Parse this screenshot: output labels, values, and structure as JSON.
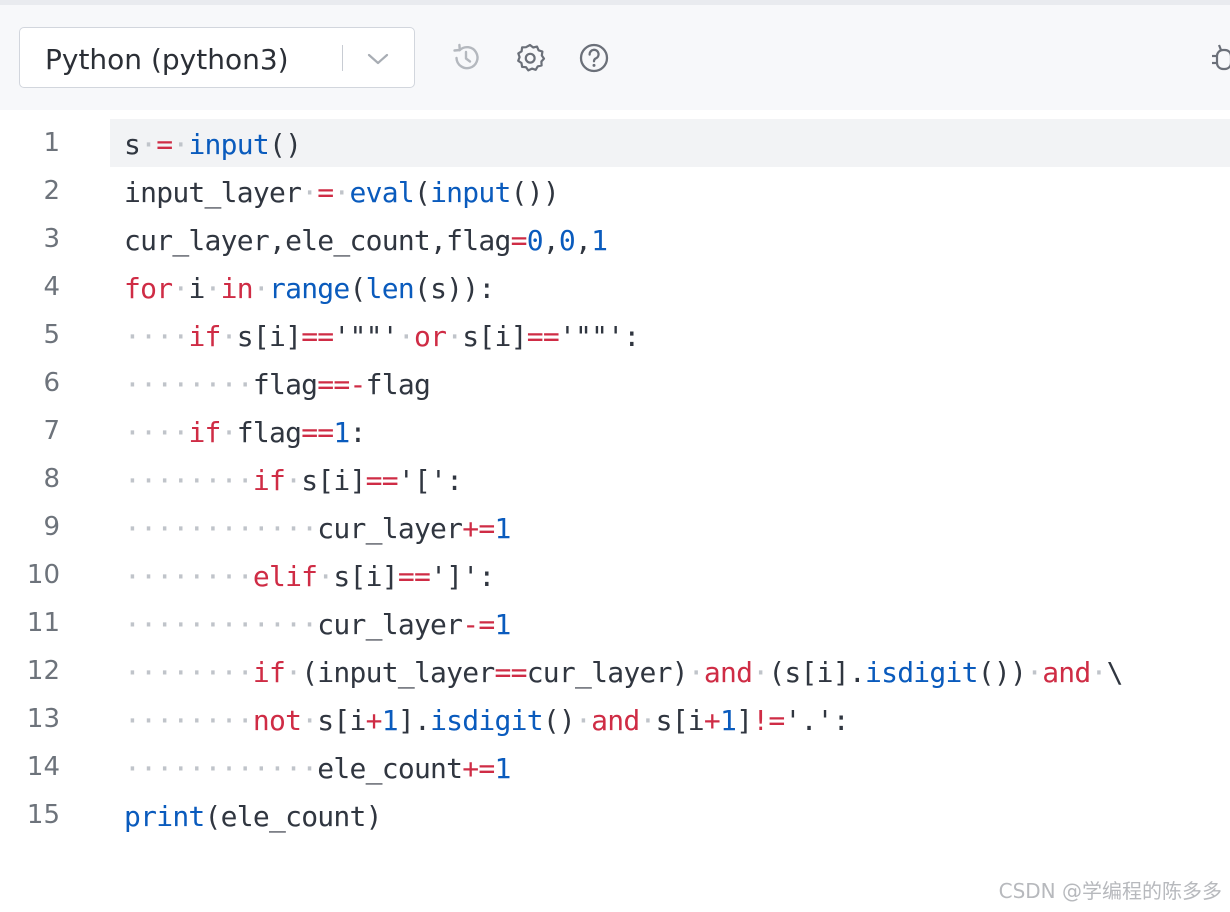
{
  "toolbar": {
    "language": "Python (python3)",
    "icons": [
      "history-icon",
      "settings-icon",
      "help-icon",
      "debug-icon"
    ]
  },
  "editor": {
    "active_line": 1,
    "lines": [
      {
        "n": "1",
        "tokens": [
          [
            "v",
            "s"
          ],
          [
            "w",
            "·"
          ],
          [
            "op",
            "="
          ],
          [
            "w",
            "·"
          ],
          [
            "fn",
            "input"
          ],
          [
            "v",
            "()"
          ]
        ]
      },
      {
        "n": "2",
        "tokens": [
          [
            "v",
            "input_layer"
          ],
          [
            "w",
            "·"
          ],
          [
            "op",
            "="
          ],
          [
            "w",
            "·"
          ],
          [
            "fn",
            "eval"
          ],
          [
            "v",
            "("
          ],
          [
            "fn",
            "input"
          ],
          [
            "v",
            "())"
          ]
        ]
      },
      {
        "n": "3",
        "tokens": [
          [
            "v",
            "cur_layer,ele_count,flag"
          ],
          [
            "op",
            "="
          ],
          [
            "num",
            "0"
          ],
          [
            "v",
            ","
          ],
          [
            "num",
            "0"
          ],
          [
            "v",
            ","
          ],
          [
            "num",
            "1"
          ]
        ]
      },
      {
        "n": "4",
        "tokens": [
          [
            "kw",
            "for"
          ],
          [
            "w",
            "·"
          ],
          [
            "v",
            "i"
          ],
          [
            "w",
            "·"
          ],
          [
            "kw",
            "in"
          ],
          [
            "w",
            "·"
          ],
          [
            "fn",
            "range"
          ],
          [
            "v",
            "("
          ],
          [
            "fn",
            "len"
          ],
          [
            "v",
            "(s)):"
          ]
        ]
      },
      {
        "n": "5",
        "tokens": [
          [
            "w",
            "····"
          ],
          [
            "kw",
            "if"
          ],
          [
            "w",
            "·"
          ],
          [
            "v",
            "s[i]"
          ],
          [
            "op",
            "=="
          ],
          [
            "v",
            "'\"\"'"
          ],
          [
            "w",
            "·"
          ],
          [
            "kw",
            "or"
          ],
          [
            "w",
            "·"
          ],
          [
            "v",
            "s[i]"
          ],
          [
            "op",
            "=="
          ],
          [
            "v",
            "'\"\"':"
          ]
        ]
      },
      {
        "n": "6",
        "tokens": [
          [
            "w",
            "········"
          ],
          [
            "v",
            "flag"
          ],
          [
            "op",
            "==-"
          ],
          [
            "v",
            "flag"
          ]
        ]
      },
      {
        "n": "7",
        "tokens": [
          [
            "w",
            "····"
          ],
          [
            "kw",
            "if"
          ],
          [
            "w",
            "·"
          ],
          [
            "v",
            "flag"
          ],
          [
            "op",
            "=="
          ],
          [
            "num",
            "1"
          ],
          [
            "v",
            ":"
          ]
        ]
      },
      {
        "n": "8",
        "tokens": [
          [
            "w",
            "········"
          ],
          [
            "kw",
            "if"
          ],
          [
            "w",
            "·"
          ],
          [
            "v",
            "s[i]"
          ],
          [
            "op",
            "=="
          ],
          [
            "v",
            "'[':"
          ]
        ]
      },
      {
        "n": "9",
        "tokens": [
          [
            "w",
            "············"
          ],
          [
            "v",
            "cur_layer"
          ],
          [
            "op",
            "+="
          ],
          [
            "num",
            "1"
          ]
        ]
      },
      {
        "n": "10",
        "tokens": [
          [
            "w",
            "········"
          ],
          [
            "kw",
            "elif"
          ],
          [
            "w",
            "·"
          ],
          [
            "v",
            "s[i]"
          ],
          [
            "op",
            "=="
          ],
          [
            "v",
            "']':"
          ]
        ]
      },
      {
        "n": "11",
        "tokens": [
          [
            "w",
            "············"
          ],
          [
            "v",
            "cur_layer"
          ],
          [
            "op",
            "-="
          ],
          [
            "num",
            "1"
          ]
        ]
      },
      {
        "n": "12",
        "tokens": [
          [
            "w",
            "········"
          ],
          [
            "kw",
            "if"
          ],
          [
            "w",
            "·"
          ],
          [
            "v",
            "(input_layer"
          ],
          [
            "op",
            "=="
          ],
          [
            "v",
            "cur_layer)"
          ],
          [
            "w",
            "·"
          ],
          [
            "kw",
            "and"
          ],
          [
            "w",
            "·"
          ],
          [
            "v",
            "(s[i]."
          ],
          [
            "fn",
            "isdigit"
          ],
          [
            "v",
            "())"
          ],
          [
            "w",
            "·"
          ],
          [
            "kw",
            "and"
          ],
          [
            "w",
            "·"
          ],
          [
            "v",
            "\\"
          ]
        ]
      },
      {
        "n": "13",
        "tokens": [
          [
            "w",
            "········"
          ],
          [
            "kw",
            "not"
          ],
          [
            "w",
            "·"
          ],
          [
            "v",
            "s[i"
          ],
          [
            "op",
            "+"
          ],
          [
            "num",
            "1"
          ],
          [
            "v",
            "]."
          ],
          [
            "fn",
            "isdigit"
          ],
          [
            "v",
            "()"
          ],
          [
            "w",
            "·"
          ],
          [
            "kw",
            "and"
          ],
          [
            "w",
            "·"
          ],
          [
            "v",
            "s[i"
          ],
          [
            "op",
            "+"
          ],
          [
            "num",
            "1"
          ],
          [
            "v",
            "]"
          ],
          [
            "op",
            "!="
          ],
          [
            "v",
            "'.':"
          ]
        ]
      },
      {
        "n": "14",
        "tokens": [
          [
            "w",
            "············"
          ],
          [
            "v",
            "ele_count"
          ],
          [
            "op",
            "+="
          ],
          [
            "num",
            "1"
          ]
        ]
      },
      {
        "n": "15",
        "tokens": [
          [
            "fn",
            "print"
          ],
          [
            "v",
            "(ele_count)"
          ]
        ]
      }
    ]
  },
  "watermark": "CSDN @学编程的陈多多",
  "colors": {
    "keyword": "#cf2c45",
    "function": "#0a5bbd",
    "text": "#303640",
    "whitespace_marker": "#c0c4ca",
    "line_number": "#6d737b",
    "active_line_bg": "#f2f3f5",
    "toolbar_bg": "#f7f8fa"
  }
}
